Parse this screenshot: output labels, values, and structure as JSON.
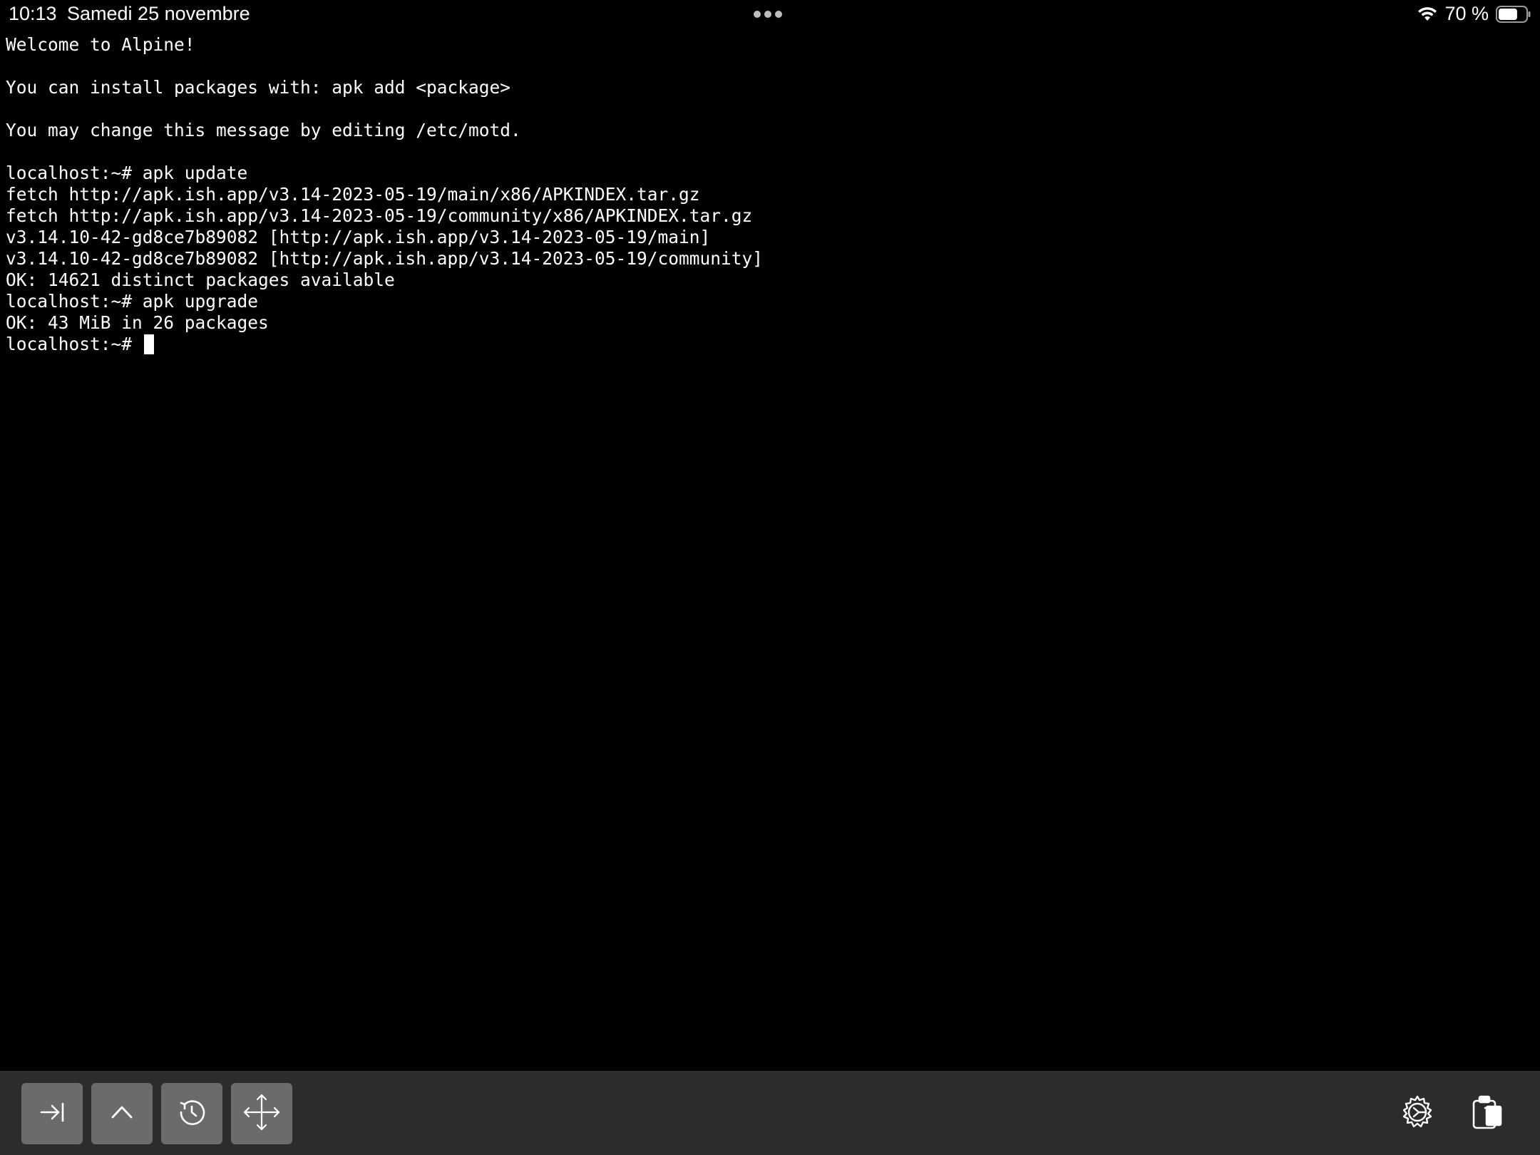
{
  "status_bar": {
    "time": "10:13",
    "date": "Samedi 25 novembre",
    "battery_text": "70 %",
    "battery_level": 0.7
  },
  "terminal": {
    "lines": [
      "Welcome to Alpine!",
      "",
      "You can install packages with: apk add <package>",
      "",
      "You may change this message by editing /etc/motd.",
      "",
      "localhost:~# apk update",
      "fetch http://apk.ish.app/v3.14-2023-05-19/main/x86/APKINDEX.tar.gz",
      "fetch http://apk.ish.app/v3.14-2023-05-19/community/x86/APKINDEX.tar.gz",
      "v3.14.10-42-gd8ce7b89082 [http://apk.ish.app/v3.14-2023-05-19/main]",
      "v3.14.10-42-gd8ce7b89082 [http://apk.ish.app/v3.14-2023-05-19/community]",
      "OK: 14621 distinct packages available",
      "localhost:~# apk upgrade",
      "OK: 43 MiB in 26 packages"
    ],
    "prompt": "localhost:~# "
  },
  "toolbar": {
    "left_keys": [
      "tab-key-icon",
      "control-key-icon",
      "escape-key-icon",
      "arrow-keys-icon"
    ],
    "right_icons": [
      "settings-gear-icon",
      "paste-clipboard-icon"
    ]
  },
  "colors": {
    "background": "#000000",
    "text": "#ffffff",
    "toolbar": "#2c2c2e",
    "key": "#6b6b6b"
  }
}
